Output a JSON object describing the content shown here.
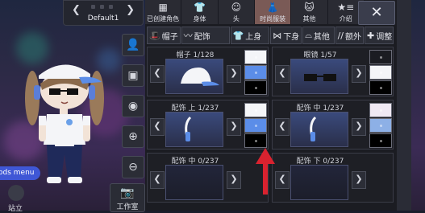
{
  "character": {
    "name": "Default1"
  },
  "left_tools": {
    "mods_menu_label": "ods menu",
    "stand_label": "站立",
    "studio_label": "工作室"
  },
  "categories": [
    {
      "label": "已创建角色",
      "icon": "character-created-icon",
      "glyph": "▦"
    },
    {
      "label": "身体",
      "icon": "body-icon",
      "glyph": "👕"
    },
    {
      "label": "头",
      "icon": "head-icon",
      "glyph": "☺"
    },
    {
      "label": "时尚服装",
      "icon": "fashion-icon",
      "glyph": "👗",
      "active": true
    },
    {
      "label": "其他",
      "icon": "other-icon",
      "glyph": "🐱"
    },
    {
      "label": "介绍",
      "icon": "profile-icon",
      "glyph": "★≡"
    }
  ],
  "close_label": "✕",
  "subtabs": [
    {
      "label": "帽子",
      "icon": "hat-icon",
      "glyph": "🎩"
    },
    {
      "label": "配饰",
      "icon": "glasses-icon",
      "glyph": "〰"
    },
    {
      "label": "上身",
      "icon": "top-icon",
      "glyph": "👕"
    },
    {
      "label": "下身",
      "icon": "pants-icon",
      "glyph": "⋈"
    },
    {
      "label": "其他",
      "icon": "other-acc-icon",
      "glyph": "⌓"
    },
    {
      "label": "额外",
      "icon": "extra-icon",
      "glyph": "//"
    },
    {
      "label": "调整",
      "icon": "adjust-icon",
      "glyph": "✚"
    }
  ],
  "slots": [
    {
      "title": "帽子 1/128",
      "item": "cap",
      "swatches": [
        "#f4f5f8",
        "#5b8de8",
        "#000000"
      ]
    },
    {
      "title": "眼镜 1/57",
      "item": "glasses",
      "swatches": [
        "#1b1c22",
        "#f4f5f8",
        "#000000"
      ]
    },
    {
      "title": "配饰 上 1/237",
      "item": "headphone",
      "swatches": [
        "#f4f5f8",
        "#5b8de8",
        "#000000"
      ]
    },
    {
      "title": "配饰 中 1/237",
      "item": "headphone",
      "swatches": [
        "#efe8f3",
        "#8db0e6",
        "#000000"
      ]
    },
    {
      "title": "配饰 中 0/237",
      "item": "none",
      "swatches": []
    },
    {
      "title": "配饰 下 0/237",
      "item": "none",
      "swatches": []
    }
  ],
  "colors": {
    "accent": "#3f57d6",
    "active_tab": "#7a5a56",
    "arrow": "#d9222f"
  }
}
